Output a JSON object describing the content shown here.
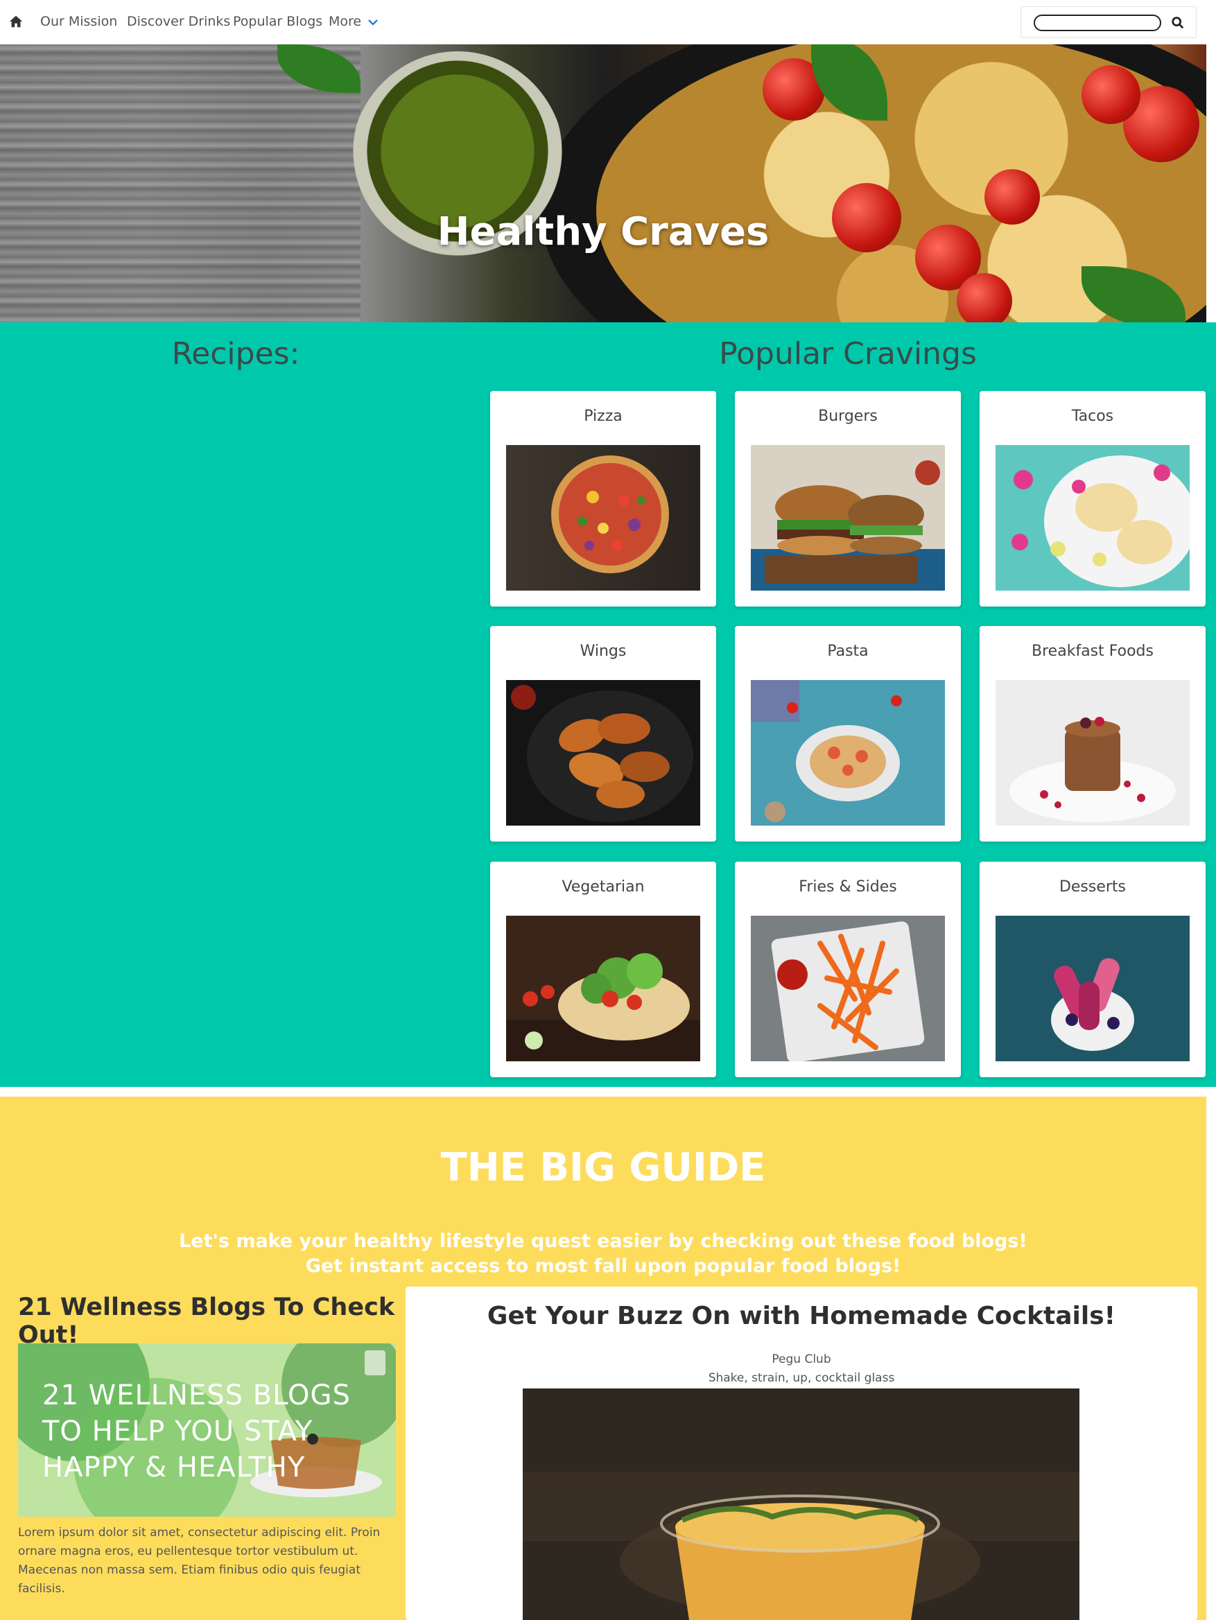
{
  "nav": {
    "links": [
      "Our Mission",
      "Discover Drinks",
      "Popular Blogs",
      "More"
    ],
    "search": {
      "placeholder": ""
    }
  },
  "hero": {
    "title": "Healthy Craves"
  },
  "recipes": {
    "heading": "Recipes:"
  },
  "popular": {
    "heading": "Popular Cravings",
    "cards": [
      {
        "title": "Pizza",
        "icon": "pizza-image"
      },
      {
        "title": "Burgers",
        "icon": "burger-image"
      },
      {
        "title": "Tacos",
        "icon": "tacos-image"
      },
      {
        "title": "Wings",
        "icon": "wings-image"
      },
      {
        "title": "Pasta",
        "icon": "pasta-image"
      },
      {
        "title": "Breakfast Foods",
        "icon": "pancakes-image"
      },
      {
        "title": "Vegetarian",
        "icon": "vegetarian-image"
      },
      {
        "title": "Fries & Sides",
        "icon": "fries-image"
      },
      {
        "title": "Desserts",
        "icon": "popsicles-image"
      }
    ]
  },
  "guide": {
    "title": "THE BIG GUIDE",
    "subtitle_line1": "Let's make your healthy lifestyle quest easier by checking out these food blogs!",
    "subtitle_line2": "Get instant access to most fall upon popular food blogs!"
  },
  "wellness": {
    "title": "21 Wellness Blogs To Check Out!",
    "image_text_line1": "21 WELLNESS BLOGS",
    "image_text_line2": "TO HELP YOU STAY",
    "image_text_line3": "HAPPY & HEALTHY",
    "body_line1": "Lorem ipsum dolor sit amet, consectetur adipiscing elit. Proin",
    "body_line2": "ornare magna eros, eu pellentesque tortor vestibulum ut.",
    "body_line3": "Maecenas non massa sem. Etiam finibus odio quis feugiat facilisis."
  },
  "cocktail": {
    "title": "Get Your Buzz On with Homemade Cocktails!",
    "name": "Pegu Club",
    "description": "Shake, strain, up, cocktail glass"
  },
  "colors": {
    "teal": "#00c9ab",
    "yellow": "#fddc5c",
    "nav_chevron": "#2b7bd6"
  }
}
